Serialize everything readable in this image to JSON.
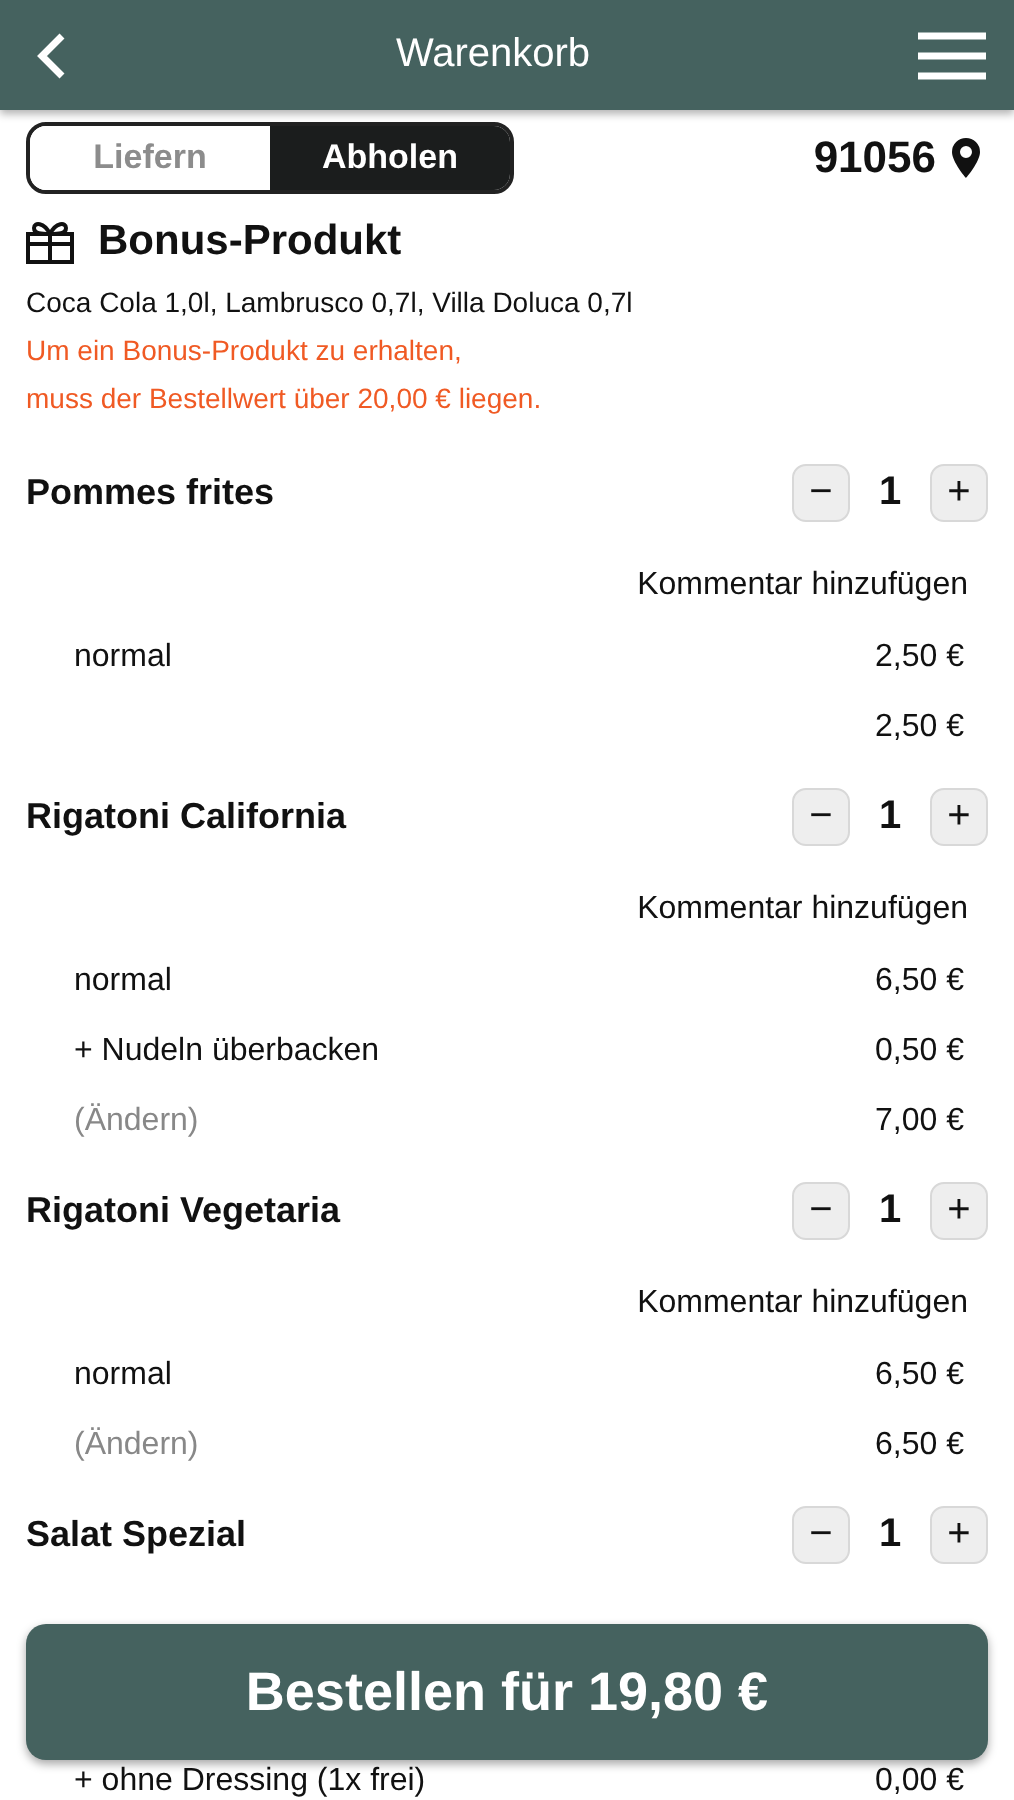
{
  "header": {
    "title": "Warenkorb"
  },
  "mode_toggle": [
    {
      "label": "Liefern",
      "selected": false
    },
    {
      "label": "Abholen",
      "selected": true
    }
  ],
  "postcode": "91056",
  "bonus": {
    "title": "Bonus-Produkt",
    "items": "Coca Cola 1,0l, Lambrusco 0,7l, Villa Doluca 0,7l",
    "notice_lines": [
      "Um ein Bonus-Produkt zu erhalten,",
      "muss der Bestellwert über 20,00 € liegen."
    ]
  },
  "products": [
    {
      "name": "Pommes frites",
      "quantity": "1",
      "minus": "−",
      "plus": "+",
      "comment_link": "Kommentar hinzufügen",
      "options": [
        {
          "label": "normal",
          "price": "2,50 €"
        }
      ],
      "total": "2,50 €"
    },
    {
      "name": "Rigatoni California",
      "quantity": "1",
      "minus": "−",
      "plus": "+",
      "comment_link": "Kommentar hinzufügen",
      "options": [
        {
          "label": "normal",
          "price": "6,50 €"
        },
        {
          "label": "+ Nudeln überbacken",
          "price": "0,50 €"
        }
      ],
      "change_link": "(Ändern)",
      "total": "7,00 €"
    },
    {
      "name": "Rigatoni Vegetaria",
      "quantity": "1",
      "minus": "−",
      "plus": "+",
      "comment_link": "Kommentar hinzufügen",
      "options": [
        {
          "label": "normal",
          "price": "6,50 €"
        }
      ],
      "change_link": "(Ändern)",
      "total": "6,50 €"
    },
    {
      "name": "Salat Spezial",
      "quantity": "1",
      "minus": "−",
      "plus": "+",
      "options": [
        {
          "label": "+ ohne Dressing (1x frei)",
          "price": "0,00 €"
        }
      ]
    }
  ],
  "order_button": "Bestellen für 19,80 €"
}
